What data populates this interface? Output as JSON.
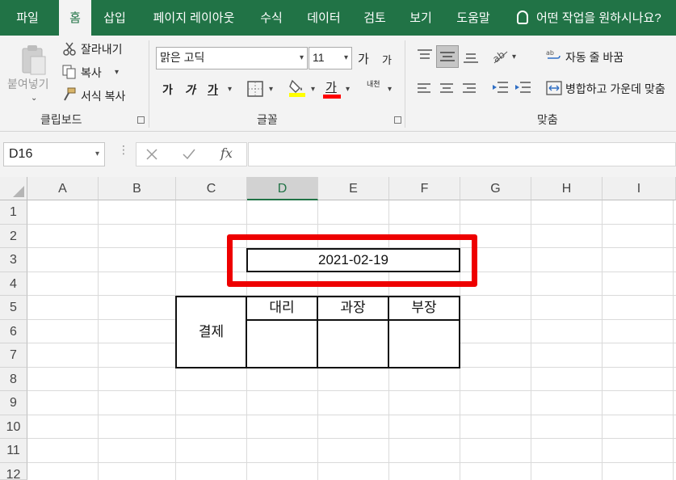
{
  "tabs": [
    "파일",
    "홈",
    "삽입",
    "페이지 레이아웃",
    "수식",
    "데이터",
    "검토",
    "보기",
    "도움말"
  ],
  "active_tab": "홈",
  "tell_me": "어떤 작업을 원하시나요?",
  "clipboard": {
    "paste": "붙여넣기",
    "cut": "잘라내기",
    "copy": "복사",
    "format_painter": "서식 복사",
    "label": "클립보드"
  },
  "font": {
    "name": "맑은 고딕",
    "size": "11",
    "grow": "가",
    "shrink": "가",
    "bold": "가",
    "italic": "가",
    "underline": "가",
    "color_letter": "가",
    "phonetic": "내천",
    "label": "글꼴",
    "fill_color": "#ffff00",
    "font_color": "#ff0000"
  },
  "alignment": {
    "wrap": "자동 줄 바꿈",
    "merge": "병합하고 가운데 맞춤",
    "label": "맞춤"
  },
  "formula_bar": {
    "name_box": "D16",
    "fx": "fx",
    "value": ""
  },
  "columns": [
    "A",
    "B",
    "C",
    "D",
    "E",
    "F",
    "G",
    "H",
    "I"
  ],
  "selected_column": "D",
  "rows": [
    "1",
    "2",
    "3",
    "4",
    "5",
    "6",
    "7",
    "8",
    "9",
    "10",
    "11",
    "12"
  ],
  "sheet": {
    "date": "2021-02-19",
    "approval_label": "결제",
    "approvers": [
      "대리",
      "과장",
      "부장"
    ],
    "highlight_color": "#ee0000"
  }
}
